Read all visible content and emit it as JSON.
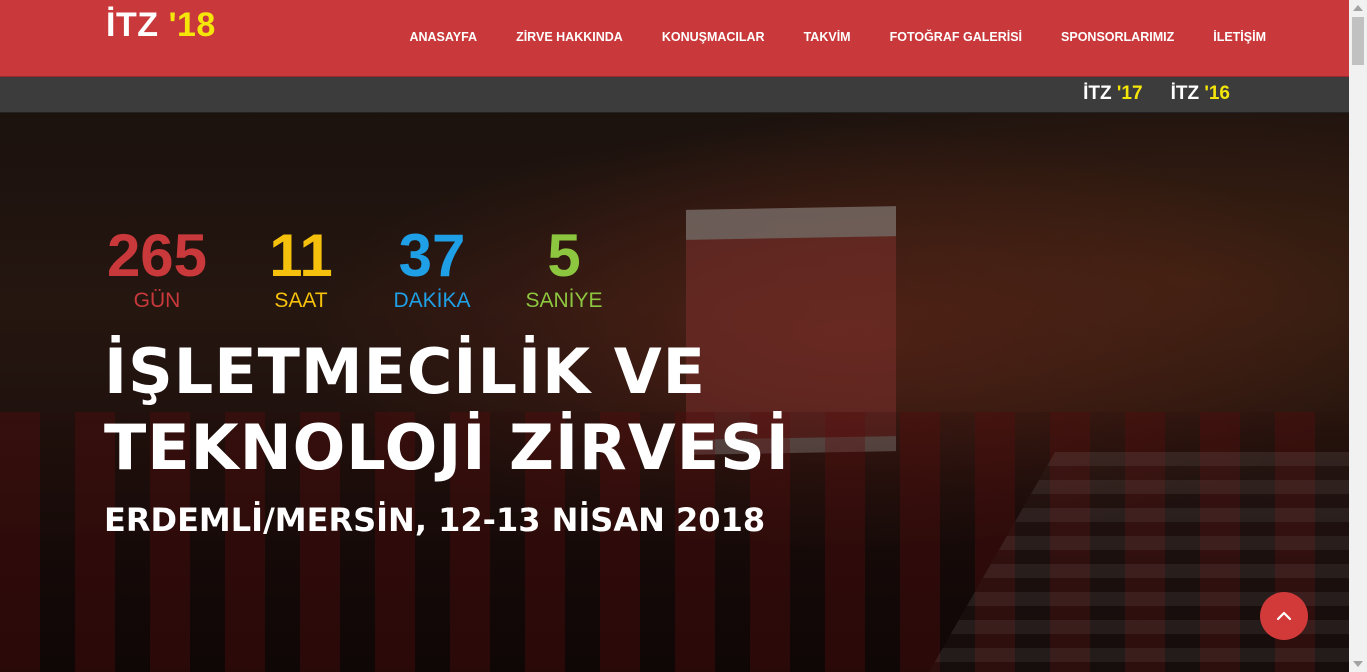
{
  "header": {
    "logo_text": "İTZ",
    "logo_year": "'18",
    "nav": [
      {
        "label": "ANASAYFA"
      },
      {
        "label": "ZİRVE HAKKINDA"
      },
      {
        "label": "KONUŞMACILAR"
      },
      {
        "label": "TAKVİM"
      },
      {
        "label": "FOTOĞRAF GALERİSİ"
      },
      {
        "label": "SPONSORLARIMIZ"
      },
      {
        "label": "İLETİŞİM"
      }
    ]
  },
  "subbar": {
    "links": [
      {
        "text": "İTZ",
        "year": "'17"
      },
      {
        "text": "İTZ",
        "year": "'16"
      }
    ]
  },
  "countdown": {
    "days": {
      "value": "265",
      "label": "GÜN"
    },
    "hours": {
      "value": "11",
      "label": "SAAT"
    },
    "minutes": {
      "value": "37",
      "label": "DAKİKA"
    },
    "seconds": {
      "value": "5",
      "label": "SANİYE"
    }
  },
  "hero": {
    "title": "İŞLETMECİLİK VE TEKNOLOJİ ZİRVESİ",
    "subtitle": "ERDEMLİ/MERSİN, 12-13 NİSAN 2018"
  },
  "icons": {
    "scroll_top": "chevron-up-icon"
  },
  "colors": {
    "brand_red": "#c9393b",
    "accent_yellow": "#f5e60a",
    "hours_color": "#f5c10c",
    "minutes_color": "#1fa0e6",
    "seconds_color": "#8dc63f"
  }
}
